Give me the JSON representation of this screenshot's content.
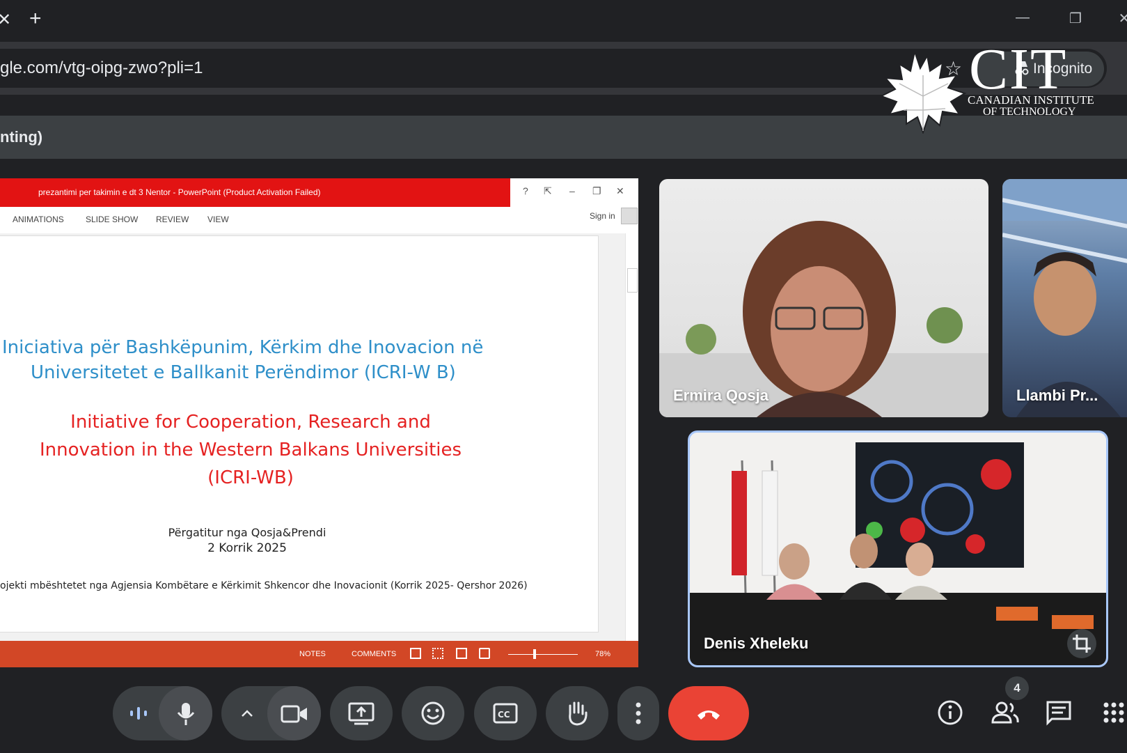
{
  "browser": {
    "url": "gle.com/vtg-oipg-zwo?pli=1",
    "incognito_label": "Incognito",
    "new_tab_icon": "plus-icon",
    "close_tab_icon": "close-icon"
  },
  "meet": {
    "header_title": "nting)",
    "participants_count": "4",
    "participants": [
      {
        "name": "Ermira Qosja"
      },
      {
        "name": "Llambi Pr..."
      },
      {
        "name": "Denis Xheleku"
      }
    ]
  },
  "logo": {
    "abbr": "CIT",
    "line1": "CANADIAN INSTITUTE",
    "line2": "OF TECHNOLOGY"
  },
  "powerpoint": {
    "window_title": "prezantimi per takimin e dt 3 Nentor -  PowerPoint (Product Activation Failed)",
    "window_help": "?",
    "ribbon_tabs": [
      "ANIMATIONS",
      "SLIDE SHOW",
      "REVIEW",
      "VIEW"
    ],
    "sign_in": "Sign in",
    "status_notes": "NOTES",
    "status_comments": "COMMENTS",
    "zoom": "78%",
    "slide": {
      "al_title_line1": "Iniciativa për Bashkëpunim, Kërkim  dhe Inovacion në",
      "al_title_line2": "Universitetet e Ballkanit Perëndimor (ICRI-W B)",
      "en_title_line1": "Initiative for Cooperation, Research and",
      "en_title_line2": "Innovation in the Western Balkans Universities",
      "en_title_line3": "(ICRI-WB)",
      "prepared_by": "Përgatitur nga Qosja&Prendi",
      "date": "2  Korrik 2025",
      "footer": "ojekti mbështetet nga Agjensia Kombëtare e Kërkimit Shkencor dhe Inovacionit (Korrik 2025- Qershor 2026)"
    }
  },
  "controls": {
    "icons": [
      "audio-level-icon",
      "microphone-icon",
      "chevron-up-icon",
      "camera-icon",
      "present-screen-icon",
      "emoji-icon",
      "captions-icon",
      "raise-hand-icon",
      "more-options-icon",
      "leave-call-icon",
      "info-icon",
      "people-icon",
      "chat-icon",
      "apps-icon"
    ],
    "leave_color": "#ea4335"
  },
  "colors": {
    "ppt_title_bar": "#e21313",
    "ppt_status_bar": "#d24726",
    "slide_title_blue": "#2e8fc9",
    "slide_title_red": "#e52222",
    "active_speaker_border": "#a8c7fa"
  }
}
